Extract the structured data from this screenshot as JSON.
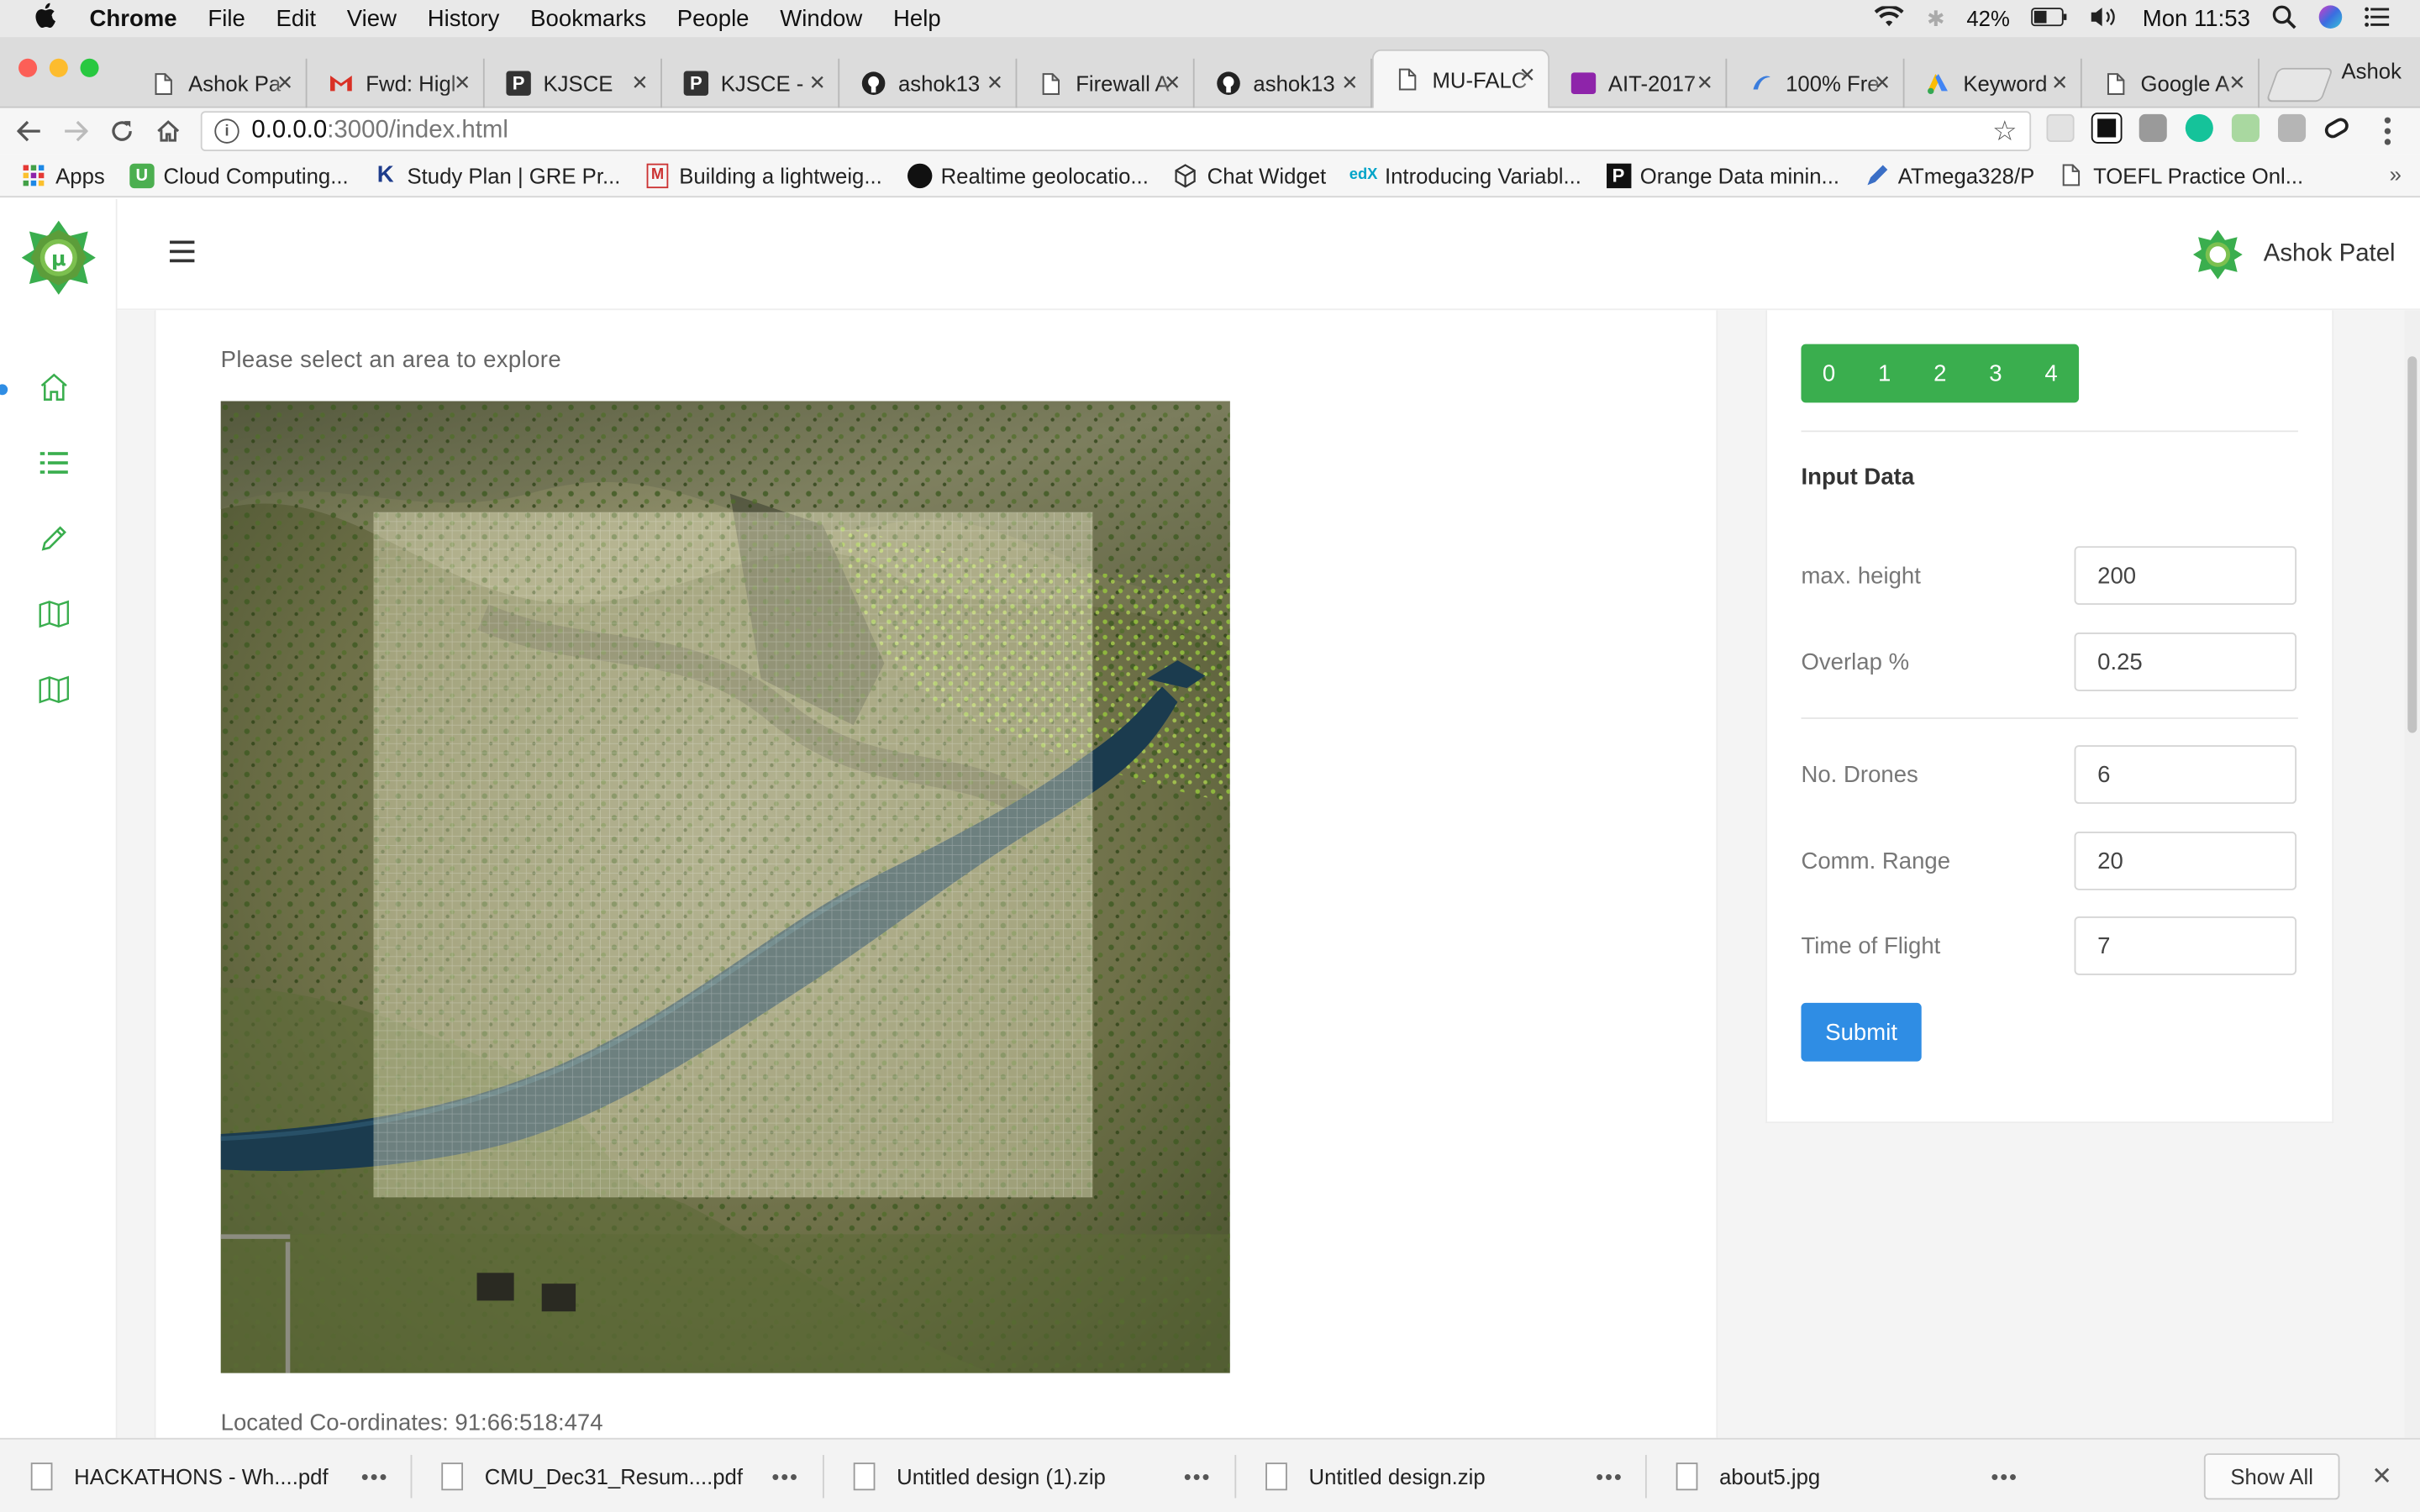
{
  "menubar": {
    "app": "Chrome",
    "items": [
      "File",
      "Edit",
      "View",
      "History",
      "Bookmarks",
      "People",
      "Window",
      "Help"
    ],
    "battery": "42%",
    "clock": "Mon 11:53"
  },
  "tabs": [
    {
      "label": "Ashok Pa",
      "icon": "doc"
    },
    {
      "label": "Fwd: Higl",
      "icon": "gmail"
    },
    {
      "label": "KJSCE",
      "icon": "p"
    },
    {
      "label": "KJSCE - ",
      "icon": "p"
    },
    {
      "label": "ashok13",
      "icon": "github"
    },
    {
      "label": "Firewall A",
      "icon": "doc"
    },
    {
      "label": "ashok13",
      "icon": "github"
    },
    {
      "label": "MU-FALC",
      "icon": "doc",
      "active": true
    },
    {
      "label": "AIT-2017",
      "icon": "purple"
    },
    {
      "label": "100% Fre",
      "icon": "swirl"
    },
    {
      "label": "Keyword",
      "icon": "adwords"
    },
    {
      "label": "Google A",
      "icon": "doc"
    }
  ],
  "profile_name": "Ashok",
  "address": {
    "host": "0.0.0.0",
    "rest": ":3000/index.html"
  },
  "bookmarks": [
    {
      "label": "Apps",
      "icon": "apps"
    },
    {
      "label": "Cloud Computing...",
      "icon": "U"
    },
    {
      "label": "Study Plan | GRE Pr...",
      "icon": "K"
    },
    {
      "label": "Building a lightweig...",
      "icon": "M"
    },
    {
      "label": "Realtime geolocatio...",
      "icon": "pin"
    },
    {
      "label": "Chat Widget",
      "icon": "cube"
    },
    {
      "label": "Introducing Variabl...",
      "icon": "edx"
    },
    {
      "label": "Orange Data minin...",
      "icon": "P"
    },
    {
      "label": "ATmega328/P",
      "icon": "pen"
    },
    {
      "label": "TOEFL Practice Onl...",
      "icon": "doc"
    }
  ],
  "logo_letter": "μ",
  "user": {
    "name": "Ashok Patel"
  },
  "main": {
    "prompt": "Please select an area to explore",
    "coords": "Located Co-ordinates: 91:66:518:474"
  },
  "pager": [
    "0",
    "1",
    "2",
    "3",
    "4"
  ],
  "form": {
    "title": "Input Data",
    "fields": [
      {
        "label": "max. height",
        "value": "200"
      },
      {
        "label": "Overlap %",
        "value": "0.25"
      },
      {
        "label": "No. Drones",
        "value": "6"
      },
      {
        "label": "Comm. Range",
        "value": "20"
      },
      {
        "label": "Time of Flight",
        "value": "7"
      }
    ],
    "submit": "Submit"
  },
  "downloads": [
    {
      "name": "HACKATHONS  - Wh....pdf"
    },
    {
      "name": "CMU_Dec31_Resum....pdf"
    },
    {
      "name": "Untitled design (1).zip"
    },
    {
      "name": "Untitled design.zip"
    },
    {
      "name": "about5.jpg"
    }
  ],
  "show_all": "Show All",
  "colors": {
    "accent_green": "#3aae4e",
    "accent_blue": "#2f8de4"
  }
}
